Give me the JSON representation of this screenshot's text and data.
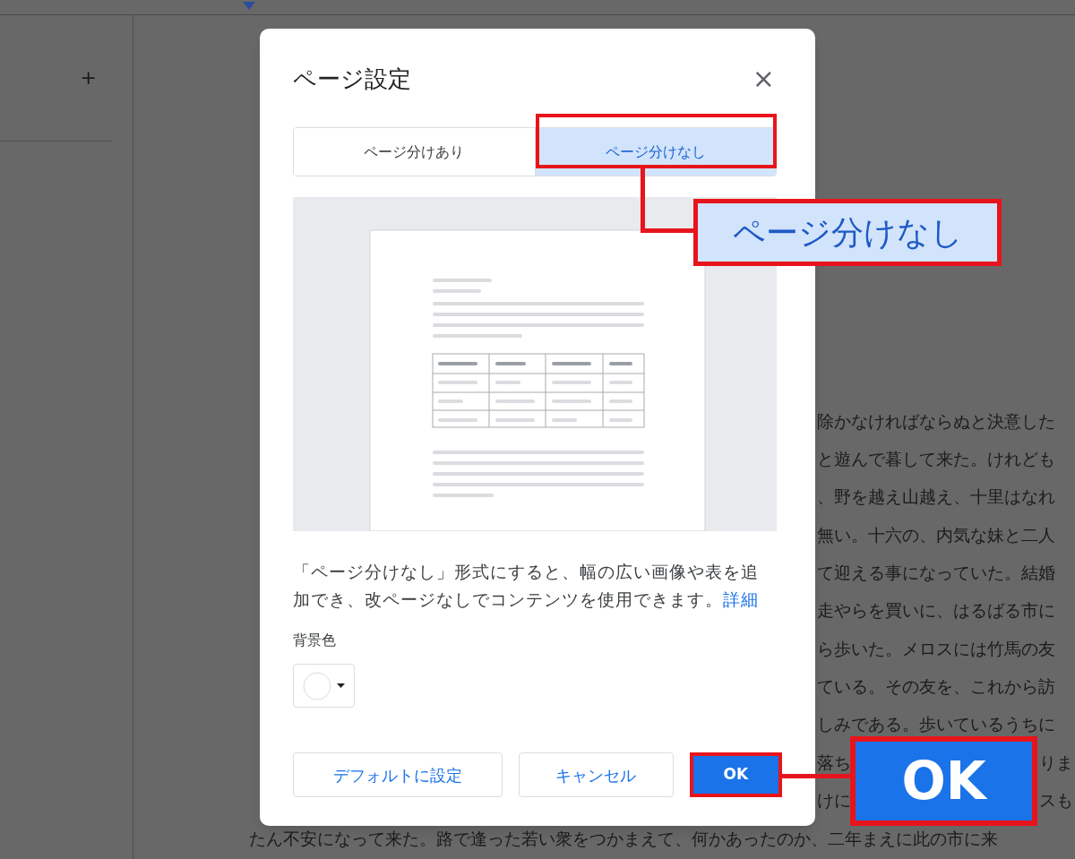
{
  "sidebar": {
    "add_label": "+"
  },
  "document": {
    "lines": [
      {
        "right": "除かなければならぬと決意した"
      },
      {
        "right": "と遊んで暮して来た。けれども"
      },
      {
        "right": "、野を越え山越え、十里はなれ"
      },
      {
        "right": "無い。十六の、内気な妹と二人"
      },
      {
        "right": "て迎える事になっていた。結婚"
      },
      {
        "right": "走やらを買いに、はるばる市に"
      },
      {
        "right": "ら歩いた。メロスには竹馬の友"
      },
      {
        "right": "ている。その友を、これから訪"
      },
      {
        "right": "しみである。歩いているうちに"
      },
      {
        "right": "落ち",
        "right_end": "りま"
      },
      {
        "right": "けに",
        "right_end": "スも"
      }
    ],
    "bottom_line": "たん不安になって来た。路で逢った若い衆をつかまえて、何かあったのか、二年まえに此の市に来"
  },
  "dialog": {
    "title": "ページ設定",
    "close": "×",
    "tabs": [
      {
        "label": "ページ分けあり",
        "selected": false
      },
      {
        "label": "ページ分けなし",
        "selected": true
      }
    ],
    "description": "「ページ分けなし」形式にすると、幅の広い画像や表を追加でき、改ページなしでコンテンツを使用できます。",
    "link": "詳細",
    "background_label": "背景色",
    "buttons": [
      {
        "label": "デフォルトに設定",
        "kind": "outline"
      },
      {
        "label": "キャンセル",
        "kind": "outline"
      },
      {
        "label": "OK",
        "kind": "primary"
      }
    ]
  },
  "callouts": [
    {
      "text": "ページ分けなし",
      "kind": "tab"
    },
    {
      "text": "OK",
      "kind": "button"
    }
  ]
}
